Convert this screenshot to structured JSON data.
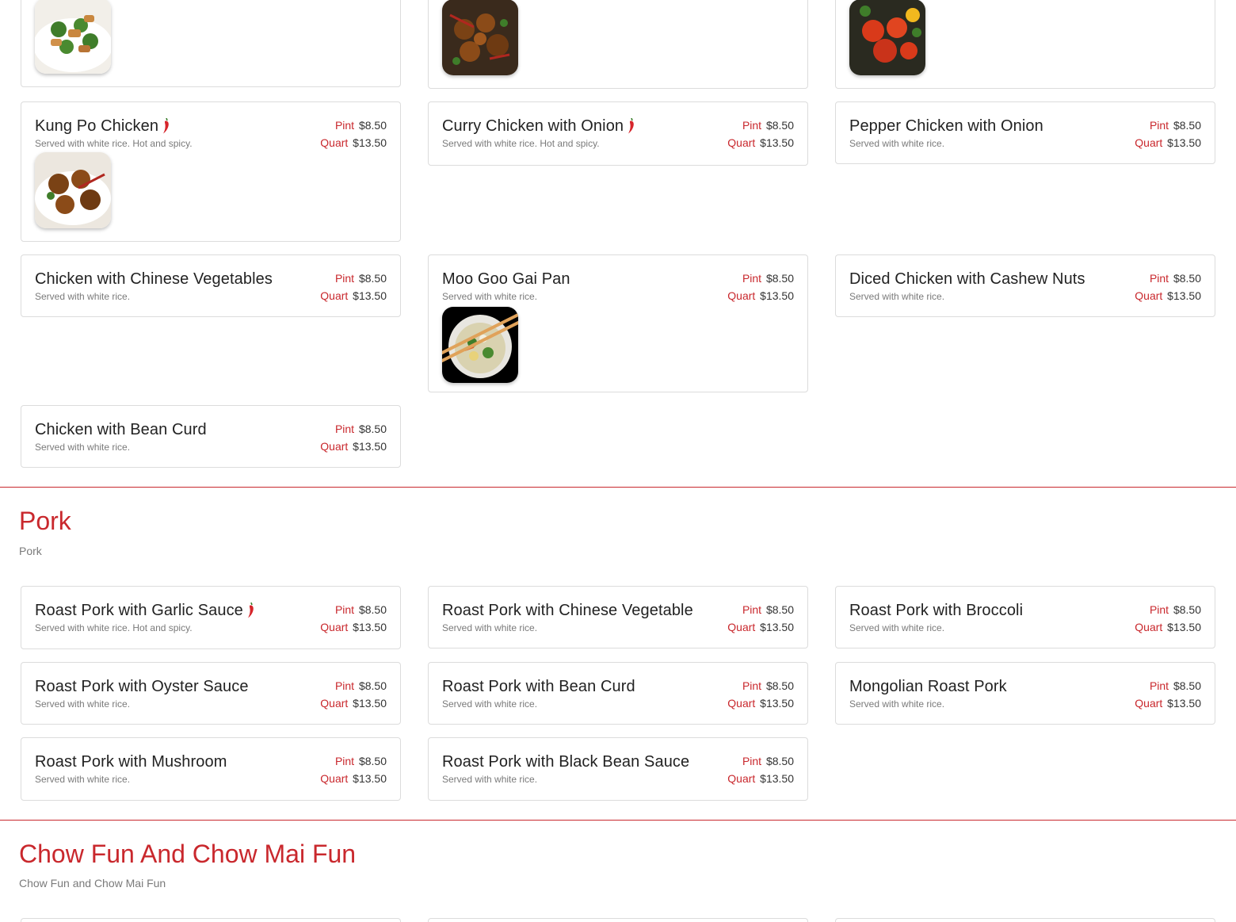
{
  "colors": {
    "accent": "#c9282d",
    "card_border": "#dcdcdc",
    "muted_text": "#7a7a7a"
  },
  "price_labels": {
    "pint": "Pint",
    "quart": "Quart"
  },
  "chicken": {
    "items": [
      {
        "name": "Kung Po Chicken",
        "desc": "Served with white rice. Hot and spicy.",
        "spicy": true,
        "pint": "$8.50",
        "quart": "$13.50"
      },
      {
        "name": "Curry Chicken with Onion",
        "desc": "Served with white rice. Hot and spicy.",
        "spicy": true,
        "pint": "$8.50",
        "quart": "$13.50"
      },
      {
        "name": "Pepper Chicken with Onion",
        "desc": "Served with white rice.",
        "spicy": false,
        "pint": "$8.50",
        "quart": "$13.50"
      },
      {
        "name": "Chicken with Chinese Vegetables",
        "desc": "Served with white rice.",
        "spicy": false,
        "pint": "$8.50",
        "quart": "$13.50"
      },
      {
        "name": "Moo Goo Gai Pan",
        "desc": "Served with white rice.",
        "spicy": false,
        "pint": "$8.50",
        "quart": "$13.50"
      },
      {
        "name": "Diced Chicken with Cashew Nuts",
        "desc": "Served with white rice.",
        "spicy": false,
        "pint": "$8.50",
        "quart": "$13.50"
      },
      {
        "name": "Chicken with Bean Curd",
        "desc": "Served with white rice.",
        "spicy": false,
        "pint": "$8.50",
        "quart": "$13.50"
      }
    ]
  },
  "pork": {
    "title": "Pork",
    "subtitle": "Pork",
    "items": [
      {
        "name": "Roast Pork with Garlic Sauce",
        "desc": "Served with white rice. Hot and spicy.",
        "spicy": true,
        "pint": "$8.50",
        "quart": "$13.50"
      },
      {
        "name": "Roast Pork with Chinese Vegetable",
        "desc": "Served with white rice.",
        "spicy": false,
        "pint": "$8.50",
        "quart": "$13.50"
      },
      {
        "name": "Roast Pork with Broccoli",
        "desc": "Served with white rice.",
        "spicy": false,
        "pint": "$8.50",
        "quart": "$13.50"
      },
      {
        "name": "Roast Pork with Oyster Sauce",
        "desc": "Served with white rice.",
        "spicy": false,
        "pint": "$8.50",
        "quart": "$13.50"
      },
      {
        "name": "Roast Pork with Bean Curd",
        "desc": "Served with white rice.",
        "spicy": false,
        "pint": "$8.50",
        "quart": "$13.50"
      },
      {
        "name": "Mongolian Roast Pork",
        "desc": "Served with white rice.",
        "spicy": false,
        "pint": "$8.50",
        "quart": "$13.50"
      },
      {
        "name": "Roast Pork with Mushroom",
        "desc": "Served with white rice.",
        "spicy": false,
        "pint": "$8.50",
        "quart": "$13.50"
      },
      {
        "name": "Roast Pork with Black Bean Sauce",
        "desc": "Served with white rice.",
        "spicy": false,
        "pint": "$8.50",
        "quart": "$13.50"
      }
    ]
  },
  "chowfun": {
    "title": "Chow Fun And Chow Mai Fun",
    "subtitle": "Chow Fun and Chow Mai Fun"
  }
}
